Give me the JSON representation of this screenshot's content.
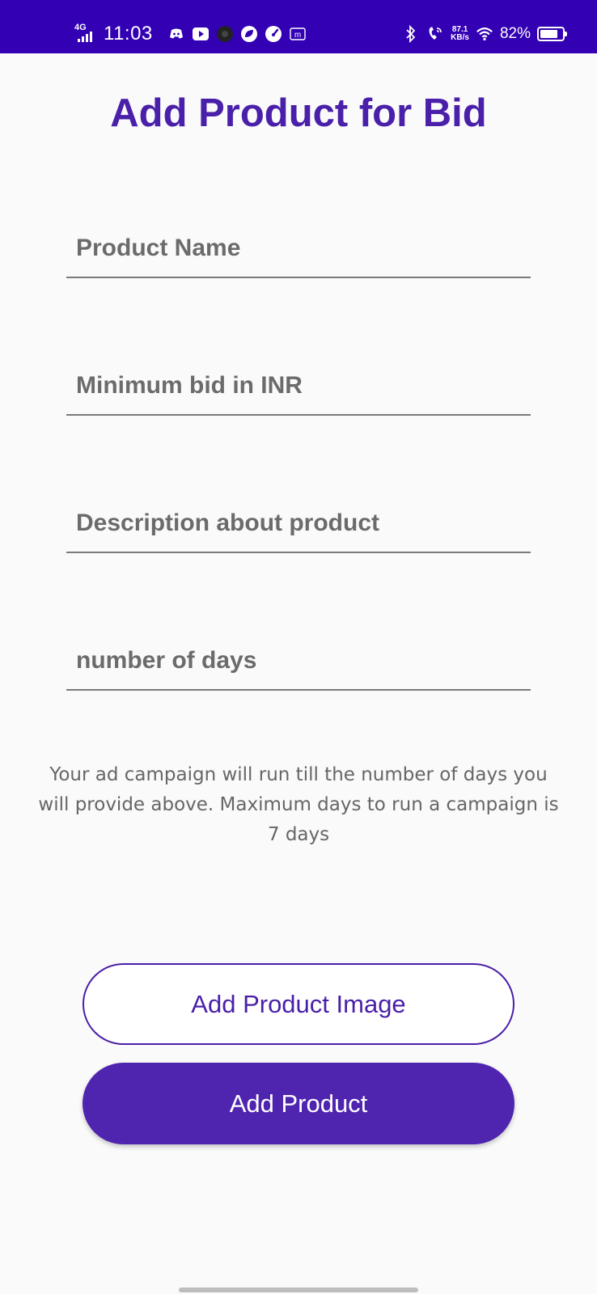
{
  "status_bar": {
    "network": "4G",
    "time": "11:03",
    "speed_value": "87.1",
    "speed_unit": "KB/s",
    "battery_pct": "82%",
    "battery_level": 0.82,
    "notification_icons": [
      "discord-icon",
      "youtube-icon",
      "circle-icon",
      "leaf-icon",
      "speedometer-icon",
      "m-app-icon"
    ],
    "bg_color": "#3300b3"
  },
  "page": {
    "title": "Add Product for Bid",
    "title_color": "#4a20aa"
  },
  "form": {
    "product_name_placeholder": "Product Name",
    "min_bid_placeholder": "Minimum bid in INR",
    "description_placeholder": "Description about product",
    "days_placeholder": "number of days",
    "info_text": "Your ad campaign will run till the number of days you will provide above. Maximum days to run a campaign is 7 days"
  },
  "buttons": {
    "add_image_label": "Add Product Image",
    "add_product_label": "Add Product",
    "accent_color": "#4f25b0"
  }
}
